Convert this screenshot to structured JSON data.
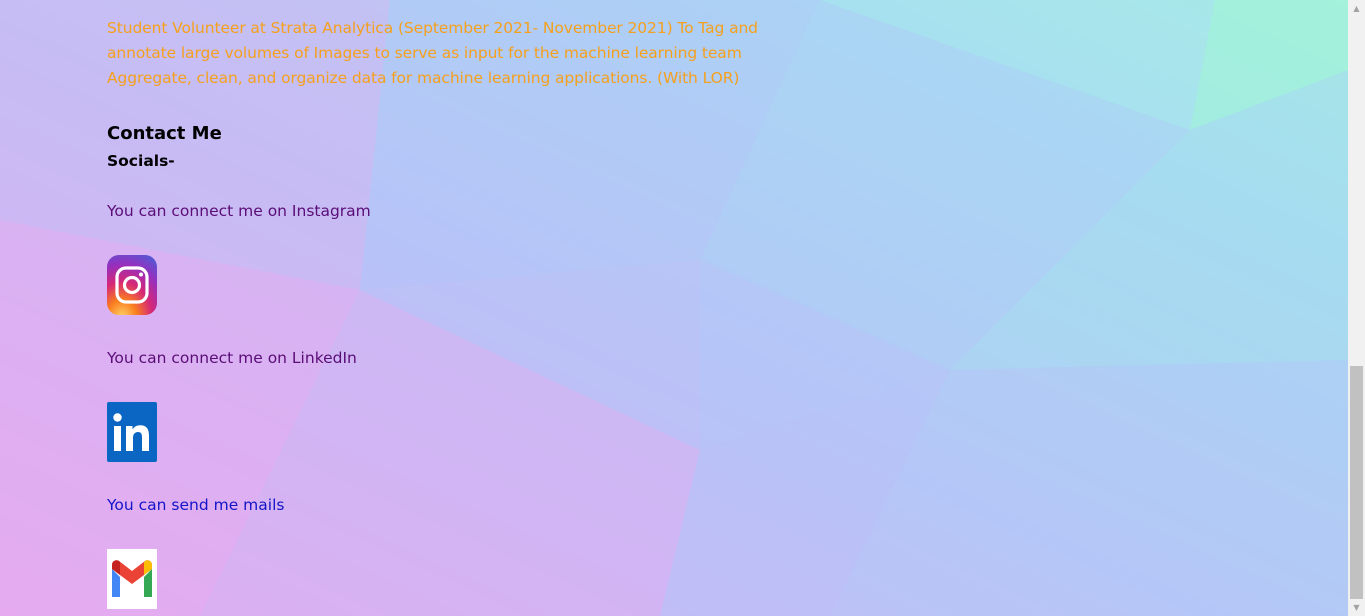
{
  "experience": {
    "text": "Student Volunteer at Strata Analytica (September 2021- November 2021) To Tag and annotate large volumes of Images to serve as input for the machine learning team Aggregate, clean, and organize data for machine learning applications. (With LOR)"
  },
  "contact": {
    "title": "Contact Me",
    "socials_title": "Socials-",
    "instagram_text": "You can connect me on Instagram",
    "linkedin_text": "You can connect me on LinkedIn",
    "mail_text": "You can send me mails"
  },
  "icons": {
    "instagram": "instagram-icon",
    "linkedin": "linkedin-icon",
    "gmail": "gmail-icon"
  },
  "colors": {
    "experience_text": "#f5a01e",
    "connect_text": "#5a0d77",
    "mail_text": "#1414c8",
    "heading_text": "#000000"
  }
}
